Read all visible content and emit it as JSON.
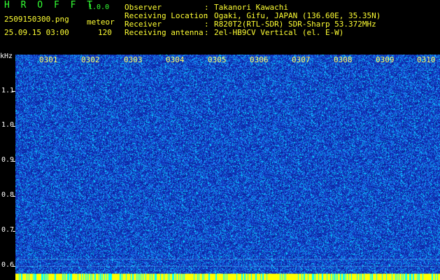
{
  "header": {
    "app_title": "H R O F F T",
    "app_version": "1.0.0",
    "file_name": "2509150300.png",
    "mode": "meteor",
    "timestamp": "25.09.15 03:00",
    "count": "120",
    "info": [
      {
        "label": "Observer",
        "value": "Takanori Kawachi"
      },
      {
        "label": "Receiving Location",
        "value": "Ogaki, Gifu, JAPAN (136.60E, 35.35N)"
      },
      {
        "label": "Receiver",
        "value": "R820T2(RTL-SDR) SDR-Sharp 53.372MHz"
      },
      {
        "label": "Receiving antenna",
        "value": "2el-HB9CV Vertical (el. E-W)"
      }
    ],
    "separator": ":"
  },
  "colors": {
    "background": "#000000",
    "header_text": "#ffff33",
    "title_text": "#33ff33",
    "axis_text": "#ffffff",
    "minute_label": "#ffff66",
    "spectrogram_base": "#1428b4",
    "spectrogram_noise": "#1e90ff",
    "spectrogram_hot": "#00ffff",
    "baseline_band": "#ffff00"
  },
  "spectrogram": {
    "y_unit": "kHz",
    "y_ticks": [
      "1.1",
      "1.0",
      "0.9",
      "0.8",
      "0.7",
      "0.6"
    ],
    "x_ticks": [
      "0301",
      "0302",
      "0303",
      "0304",
      "0305",
      "0306",
      "0307",
      "0308",
      "0309",
      "0310"
    ]
  }
}
